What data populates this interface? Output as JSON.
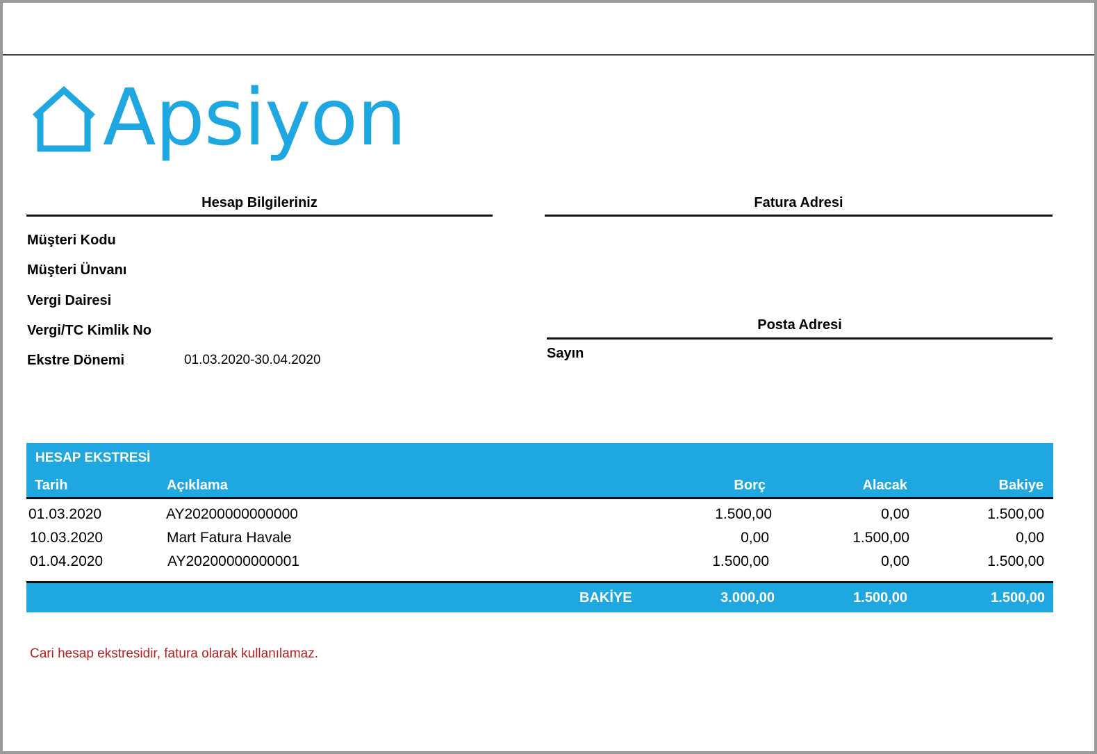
{
  "brand": {
    "name": "Apsiyon",
    "logo_icon": "house-outline-icon",
    "color": "#1ea7e1"
  },
  "account_info": {
    "title": "Hesap Bilgileriniz",
    "fields": [
      {
        "label": "Müşteri Kodu",
        "value": ""
      },
      {
        "label": "Müşteri Ünvanı",
        "value": ""
      },
      {
        "label": "Vergi Dairesi",
        "value": ""
      },
      {
        "label": "Vergi/TC Kimlik No",
        "value": ""
      },
      {
        "label": "Ekstre Dönemi",
        "value": "01.03.2020-30.04.2020"
      }
    ]
  },
  "billing_address": {
    "title": "Fatura Adresi"
  },
  "postal_address": {
    "title": "Posta Adresi",
    "salutation": "Sayın"
  },
  "statement": {
    "title": "HESAP EKSTRESİ",
    "header_color": "#1ea7e1",
    "columns": [
      "Tarih",
      "Açıklama",
      "Borç",
      "Alacak",
      "Bakiye"
    ],
    "rows": [
      {
        "date": "01.03.2020",
        "description": "AY20200000000000",
        "debit": "1.500,00",
        "credit": "0,00",
        "balance": "1.500,00"
      },
      {
        "date": "10.03.2020",
        "description": "Mart Fatura Havale",
        "debit": "0,00",
        "credit": "1.500,00",
        "balance": "0,00"
      },
      {
        "date": "01.04.2020",
        "description": "AY20200000000001",
        "debit": "1.500,00",
        "credit": "0,00",
        "balance": "1.500,00"
      }
    ],
    "total": {
      "label": "BAKİYE",
      "debit": "3.000,00",
      "credit": "1.500,00",
      "balance": "1.500,00"
    }
  },
  "note": {
    "text": "Cari hesap ekstresidir, fatura olarak kullanılamaz.",
    "color": "#b22222"
  }
}
